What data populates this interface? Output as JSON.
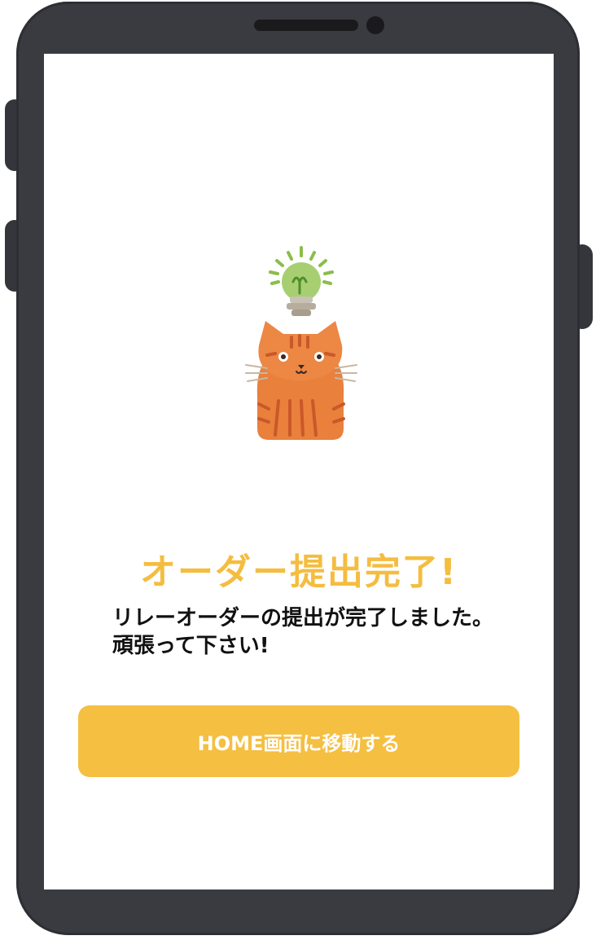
{
  "screen": {
    "title": "オーダー提出完了!",
    "message": "リレーオーダーの提出が完了しました。頑張って下さい!",
    "home_button_label": "HOME画面に移動する"
  },
  "illustration": {
    "icons": [
      "lightbulb-icon",
      "cat-icon"
    ]
  },
  "colors": {
    "accent": "#f5bf42",
    "title": "#f4bd40",
    "phone_frame": "#3a3b41"
  }
}
